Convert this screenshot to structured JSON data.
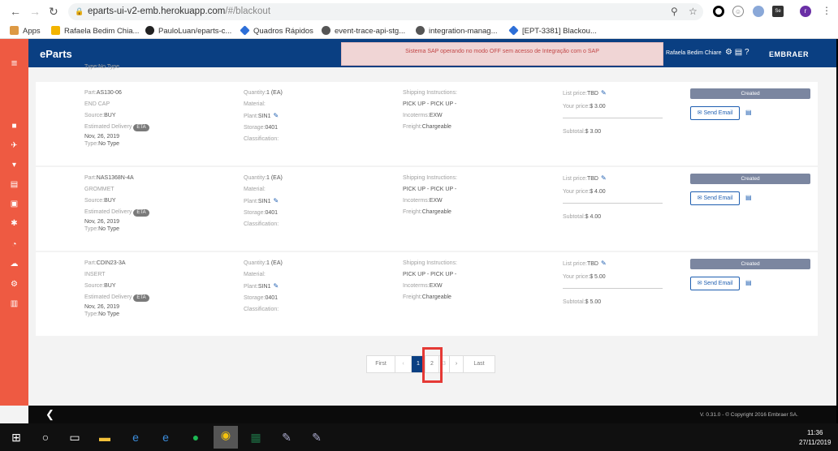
{
  "browser": {
    "url_host": "eparts-ui-v2-emb.herokuapp.com",
    "url_path": "/#/blackout",
    "avatar": "r"
  },
  "bookmarks": [
    "Apps",
    "Rafaela Bedim Chia...",
    "PauloLuan/eparts-c...",
    "Quadros Rápidos",
    "event-trace-api-stg...",
    "integration-manag...",
    "[EPT-3381] Blackou..."
  ],
  "app": {
    "brand": "eParts",
    "alert": "Sistema SAP operando no modo OFF sem acesso de Integração com o SAP",
    "user": "Rafaela Bedim Chiare",
    "logo": "EMBRAER",
    "clipped_line": "Type:No Type"
  },
  "labels": {
    "part": "Part:",
    "source": "Source:",
    "est": "Estimated Delivery",
    "eta": "ETA",
    "type": "Type:",
    "qty": "Quantity:",
    "material": "Material:",
    "plant": "Plant:",
    "storage": "Storage:",
    "class": "Classification:",
    "ship": "Shipping Instructions:",
    "inco": "Incoterms:",
    "freight": "Freight:",
    "list": "List price:",
    "your": "Your price:",
    "subtotal": "Subtotal:",
    "email": "Send Email"
  },
  "items": [
    {
      "part": "AS130-06",
      "desc": "END CAP",
      "source": "BUY",
      "date": "Nov, 26, 2019",
      "type": "No Type",
      "qty": "1 (EA)",
      "plant": "SIN1",
      "storage": "0401",
      "ship": "PICK UP - PICK UP -",
      "inco": "EXW",
      "freight": "Chargeable",
      "list": "TBD",
      "your": "$ 3.00",
      "subtotal": "$ 3.00",
      "status": "Created"
    },
    {
      "part": "NAS1368N-4A",
      "desc": "GROMMET",
      "source": "BUY",
      "date": "Nov, 26, 2019",
      "type": "No Type",
      "qty": "1 (EA)",
      "plant": "SIN1",
      "storage": "0401",
      "ship": "PICK UP - PICK UP -",
      "inco": "EXW",
      "freight": "Chargeable",
      "list": "TBD",
      "your": "$ 4.00",
      "subtotal": "$ 4.00",
      "status": "Created"
    },
    {
      "part": "CDIN23-3A",
      "desc": "INSERT",
      "source": "BUY",
      "date": "Nov, 26, 2019",
      "type": "No Type",
      "qty": "1 (EA)",
      "plant": "SIN1",
      "storage": "0401",
      "ship": "PICK UP - PICK UP -",
      "inco": "EXW",
      "freight": "Chargeable",
      "list": "TBD",
      "your": "$ 5.00",
      "subtotal": "$ 5.00",
      "status": "Created"
    }
  ],
  "pager": {
    "first": "First",
    "prev": "‹",
    "p1": "1",
    "p2": "2",
    "p3": "3",
    "next": "›",
    "last": "Last"
  },
  "footer": {
    "version": "V. 0.31.0 - © Copyright 2016 Embraer SA."
  },
  "taskbar": {
    "time": "11:36",
    "date": "27/11/2019"
  }
}
